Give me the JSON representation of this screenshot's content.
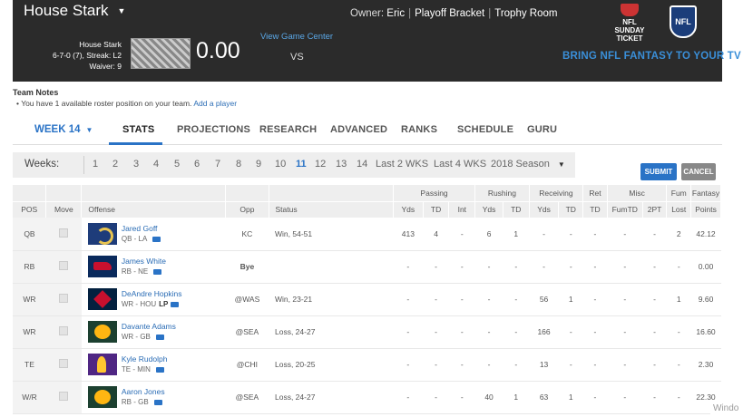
{
  "header": {
    "team_name": "House Stark",
    "owner_label": "Owner:",
    "owner_name": "Eric",
    "playoff_bracket": "Playoff Bracket",
    "trophy_room": "Trophy Room",
    "meta_team": "House Stark",
    "meta_record": "6-7-0 (7), Streak: L2",
    "meta_waiver": "Waiver: 9",
    "score": "0.00",
    "view_game_center": "View Game Center",
    "vs": "VS",
    "sunday_ticket": [
      "NFL",
      "SUNDAY",
      "TICKET"
    ],
    "nfl_logo_text": "NFL",
    "promo": "BRING NFL FANTASY TO YOUR TV ›"
  },
  "notes": {
    "title": "Team Notes",
    "message": "You have 1 available roster position on your team.",
    "add_player": "Add a player"
  },
  "tabs": {
    "week": "WEEK 14",
    "items": [
      "STATS",
      "PROJECTIONS",
      "RESEARCH",
      "ADVANCED",
      "RANKS",
      "SCHEDULE",
      "GURU"
    ]
  },
  "weeks": {
    "label": "Weeks:",
    "items": [
      "1",
      "2",
      "3",
      "4",
      "5",
      "6",
      "7",
      "8",
      "9",
      "10",
      "11",
      "12",
      "13",
      "14",
      "Last 2 WKS",
      "Last 4 WKS",
      "2018 Season"
    ],
    "active": "11"
  },
  "buttons": {
    "submit": "SUBMIT",
    "cancel": "CANCEL"
  },
  "table": {
    "groups": [
      "Passing",
      "Rushing",
      "Receiving",
      "Ret",
      "Misc",
      "Fum",
      "Fantasy"
    ],
    "columns": [
      "POS",
      "Move",
      "Offense",
      "Opp",
      "Status",
      "Yds",
      "TD",
      "Int",
      "Yds",
      "TD",
      "Yds",
      "TD",
      "TD",
      "FumTD",
      "2PT",
      "Lost",
      "Points"
    ],
    "rows": [
      {
        "pos": "QB",
        "name": "Jared Goff",
        "team": "QB - LA",
        "lp": "",
        "opp": "KC",
        "status": "Win, 54-51",
        "stats": [
          "413",
          "4",
          "-",
          "6",
          "1",
          "-",
          "-",
          "-",
          "-",
          "-",
          "2"
        ],
        "points": "42.12"
      },
      {
        "pos": "RB",
        "name": "James White",
        "team": "RB - NE",
        "lp": "",
        "opp": "Bye",
        "status": "",
        "stats": [
          "-",
          "-",
          "-",
          "-",
          "-",
          "-",
          "-",
          "-",
          "-",
          "-",
          "-"
        ],
        "points": "0.00"
      },
      {
        "pos": "WR",
        "name": "DeAndre Hopkins",
        "team": "WR - HOU",
        "lp": "LP",
        "opp": "@WAS",
        "status": "Win, 23-21",
        "stats": [
          "-",
          "-",
          "-",
          "-",
          "-",
          "56",
          "1",
          "-",
          "-",
          "-",
          "1"
        ],
        "points": "9.60"
      },
      {
        "pos": "WR",
        "name": "Davante Adams",
        "team": "WR - GB",
        "lp": "",
        "opp": "@SEA",
        "status": "Loss, 24-27",
        "stats": [
          "-",
          "-",
          "-",
          "-",
          "-",
          "166",
          "-",
          "-",
          "-",
          "-",
          "-"
        ],
        "points": "16.60"
      },
      {
        "pos": "TE",
        "name": "Kyle Rudolph",
        "team": "TE - MIN",
        "lp": "",
        "opp": "@CHI",
        "status": "Loss, 20-25",
        "stats": [
          "-",
          "-",
          "-",
          "-",
          "-",
          "13",
          "-",
          "-",
          "-",
          "-",
          "-"
        ],
        "points": "2.30"
      },
      {
        "pos": "W/R",
        "name": "Aaron Jones",
        "team": "RB - GB",
        "lp": "",
        "opp": "@SEA",
        "status": "Loss, 24-27",
        "stats": [
          "-",
          "-",
          "-",
          "40",
          "1",
          "63",
          "1",
          "-",
          "-",
          "-",
          "-"
        ],
        "points": "22.30"
      }
    ]
  },
  "watermark": "Windo"
}
